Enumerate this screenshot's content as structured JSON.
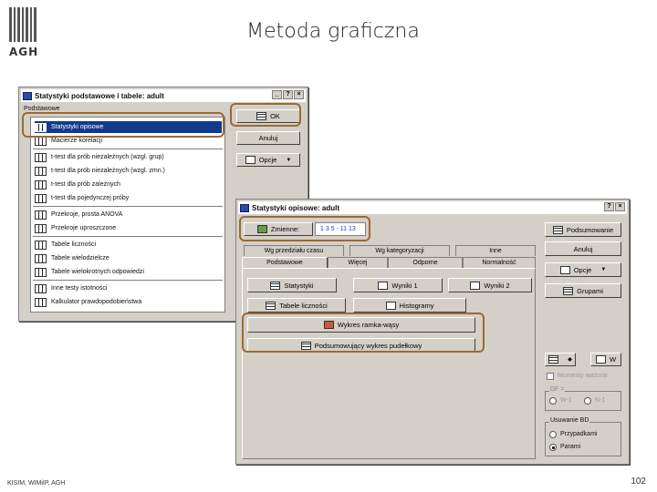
{
  "slide": {
    "logo_text": "AGH",
    "title": "Metoda graficzna",
    "footer_left": "KISIM, WIMiIP, AGH",
    "page_number": "102"
  },
  "win1": {
    "title": "Statystyki podstawowe i tabele: adult",
    "group_label": "Podstawowe",
    "items": [
      "Statystyki opisowe",
      "Macierze korelacji",
      "t-test dla prób niezależnych (wzgl. grup)",
      "t-test dla prób niezależnych (wzgl. zmn.)",
      "t-test dla prób zależnych",
      "t-test dla pojedynczej próby",
      "Przekroje, prosta ANOVA",
      "Przekroje uproszczone",
      "Tabele liczności",
      "Tabele wielodzielcze",
      "Tabele wielokrotnych odpowiedzi",
      "Inne testy istotności",
      "Kalkulator prawdopodobieństwa"
    ],
    "ok_label": "OK",
    "cancel_label": "Anuluj",
    "options_label": "Opcje"
  },
  "win2": {
    "title": "Statystyki opisowe: adult",
    "variables_label": "Zmienne:",
    "variables_value": "1 3 5 - 11 13",
    "tabs_row1": [
      "Wg przedziału czasu",
      "Wg kategoryzacji",
      "Inne"
    ],
    "tabs_row2": [
      "Podstawowe",
      "Więcej",
      "Odporne",
      "Normalność"
    ],
    "b_summary": "Statystyki",
    "b_freq": "Tabele liczności",
    "b_hist": "Histogramy",
    "b_results1": "Wyniki 1",
    "b_results2": "Wyniki 2",
    "b_boxplot": "Wykres ramka-wąsy",
    "b_box_summary": "Podsumowujący wykres pudełkowy",
    "right_summary": "Podsumowanie",
    "right_cancel": "Anuluj",
    "right_options": "Opcje",
    "right_groups": "Grupami",
    "w_label": "W",
    "moments_label": "Momenty ważone",
    "df_label": "DF =",
    "df_opt1": "W-1",
    "df_opt2": "N-1",
    "bd_label": "Usuwanie BD",
    "bd_opt1": "Przypadkami",
    "bd_opt2": "Parami"
  }
}
